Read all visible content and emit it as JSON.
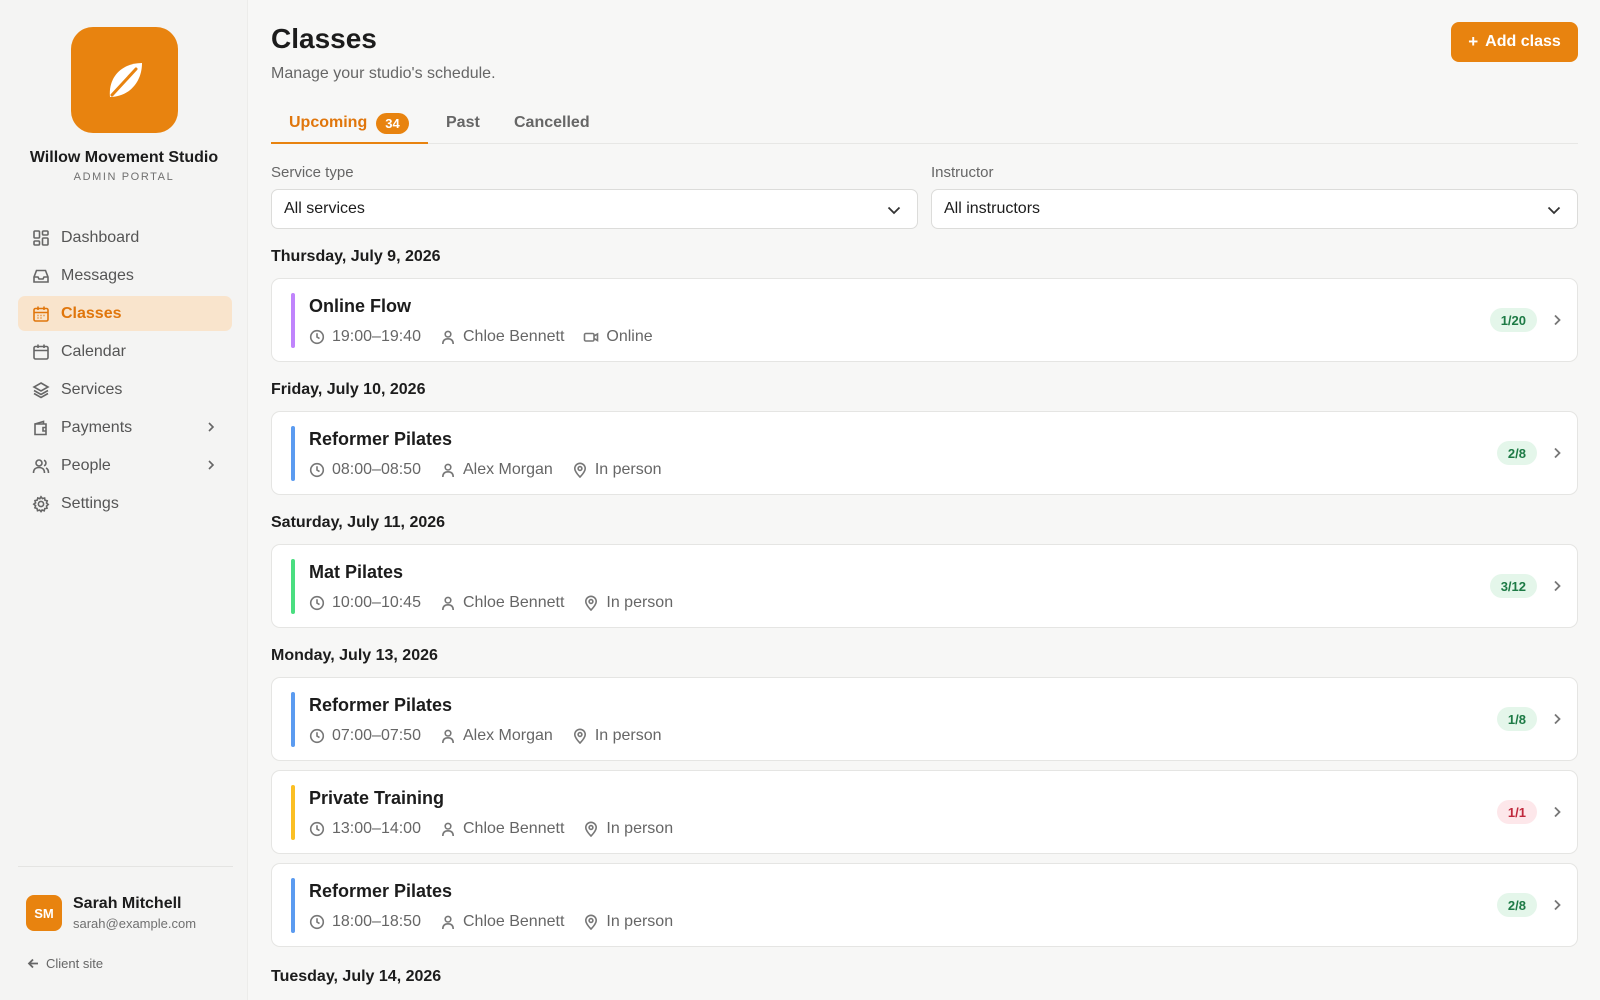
{
  "brand": {
    "name": "Willow Movement Studio",
    "subtitle": "ADMIN PORTAL",
    "logo_icon": "leaf-icon",
    "accent_color": "#e8830f"
  },
  "sidebar": {
    "items": [
      {
        "label": "Dashboard",
        "icon": "dashboard-icon",
        "active": false
      },
      {
        "label": "Messages",
        "icon": "inbox-icon",
        "active": false
      },
      {
        "label": "Classes",
        "icon": "calendar-icon",
        "active": true
      },
      {
        "label": "Calendar",
        "icon": "calendar-icon",
        "active": false
      },
      {
        "label": "Services",
        "icon": "layers-icon",
        "active": false
      },
      {
        "label": "Payments",
        "icon": "wallet-icon",
        "active": false,
        "has_children": true
      },
      {
        "label": "People",
        "icon": "users-icon",
        "active": false,
        "has_children": true
      },
      {
        "label": "Settings",
        "icon": "gear-icon",
        "active": false
      }
    ]
  },
  "user": {
    "initials": "SM",
    "name": "Sarah Mitchell",
    "email": "sarah@example.com"
  },
  "client_link": "Client site",
  "header": {
    "title": "Classes",
    "subtitle": "Manage your studio's schedule.",
    "add_button": "Add class"
  },
  "tabs": [
    {
      "label": "Upcoming",
      "count": "34",
      "active": true
    },
    {
      "label": "Past",
      "active": false
    },
    {
      "label": "Cancelled",
      "active": false
    }
  ],
  "filters": {
    "service_label": "Service type",
    "service_value": "All services",
    "instructor_label": "Instructor",
    "instructor_value": "All instructors"
  },
  "schedule": [
    {
      "date": "Thursday, July 9, 2026",
      "classes": [
        {
          "title": "Online Flow",
          "time": "19:00–19:40",
          "instructor": "Chloe Bennett",
          "location": "Online",
          "location_icon": "video-icon",
          "capacity": "1/20",
          "capacity_status": "available",
          "color": "#c084fc"
        }
      ]
    },
    {
      "date": "Friday, July 10, 2026",
      "classes": [
        {
          "title": "Reformer Pilates",
          "time": "08:00–08:50",
          "instructor": "Alex Morgan",
          "location": "In person",
          "location_icon": "pin-icon",
          "capacity": "2/8",
          "capacity_status": "available",
          "color": "#5b9bf0"
        }
      ]
    },
    {
      "date": "Saturday, July 11, 2026",
      "classes": [
        {
          "title": "Mat Pilates",
          "time": "10:00–10:45",
          "instructor": "Chloe Bennett",
          "location": "In person",
          "location_icon": "pin-icon",
          "capacity": "3/12",
          "capacity_status": "available",
          "color": "#4ade80"
        }
      ]
    },
    {
      "date": "Monday, July 13, 2026",
      "classes": [
        {
          "title": "Reformer Pilates",
          "time": "07:00–07:50",
          "instructor": "Alex Morgan",
          "location": "In person",
          "location_icon": "pin-icon",
          "capacity": "1/8",
          "capacity_status": "available",
          "color": "#5b9bf0"
        },
        {
          "title": "Private Training",
          "time": "13:00–14:00",
          "instructor": "Chloe Bennett",
          "location": "In person",
          "location_icon": "pin-icon",
          "capacity": "1/1",
          "capacity_status": "full",
          "color": "#fbbf24"
        },
        {
          "title": "Reformer Pilates",
          "time": "18:00–18:50",
          "instructor": "Chloe Bennett",
          "location": "In person",
          "location_icon": "pin-icon",
          "capacity": "2/8",
          "capacity_status": "available",
          "color": "#5b9bf0"
        }
      ]
    },
    {
      "date": "Tuesday, July 14, 2026",
      "classes": []
    }
  ]
}
